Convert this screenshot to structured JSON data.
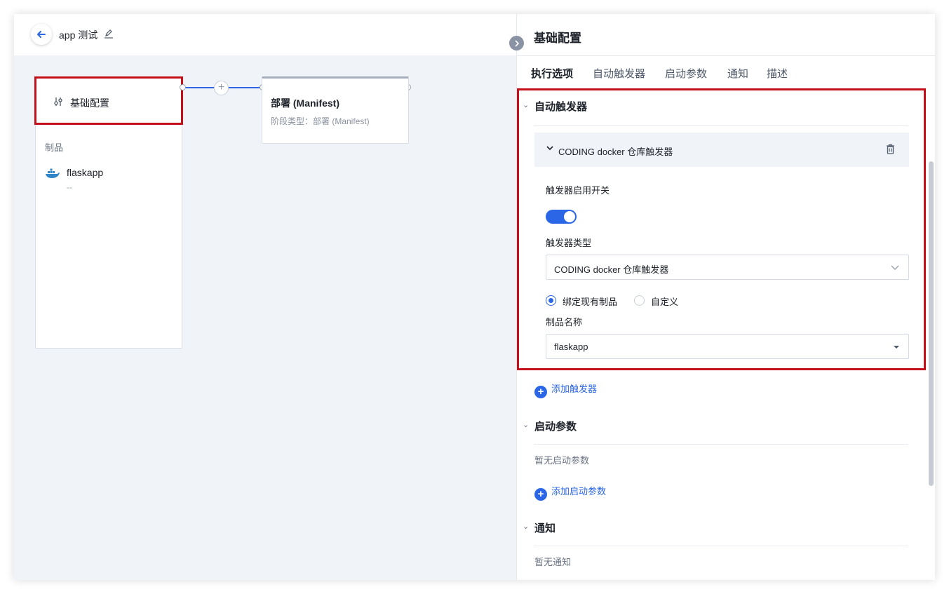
{
  "app": {
    "title": "app 测试"
  },
  "pipeline": {
    "base_stage": {
      "title": "基础配置",
      "products_label": "制品",
      "product_name": "flaskapp",
      "product_sub": "--"
    },
    "deploy_stage": {
      "title": "部署 (Manifest)",
      "subtitle": "阶段类型：部署 (Manifest)"
    },
    "add_symbol": "+"
  },
  "panel": {
    "title": "基础配置",
    "tabs": [
      "执行选项",
      "自动触发器",
      "启动参数",
      "通知",
      "描述"
    ],
    "sections": {
      "triggers": {
        "title": "自动触发器",
        "trigger_header": "CODING docker 仓库触发器",
        "switch_label": "触发器启用开关",
        "switch_on": true,
        "type_label": "触发器类型",
        "type_value": "CODING docker 仓库触发器",
        "radio_bind": "绑定现有制品",
        "radio_custom": "自定义",
        "selected_radio": "绑定现有制品",
        "product_name_label": "制品名称",
        "product_name_value": "flaskapp",
        "add_label": "添加触发器"
      },
      "params": {
        "title": "启动参数",
        "empty": "暂无启动参数",
        "add_label": "添加启动参数"
      },
      "notify": {
        "title": "通知",
        "empty": "暂无通知"
      }
    }
  },
  "colors": {
    "accent": "#2a66e6",
    "highlight": "#c4101a"
  }
}
